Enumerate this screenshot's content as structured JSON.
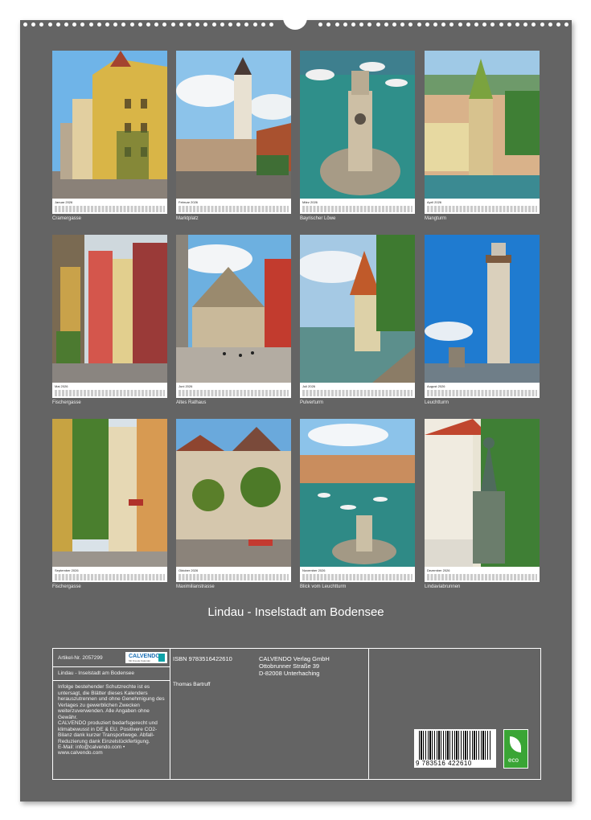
{
  "title": "Lindau - Inselstadt am Bodensee",
  "months": [
    {
      "month": "Januar 2026",
      "caption": "Cramergasse"
    },
    {
      "month": "Februar 2026",
      "caption": "Marktplatz"
    },
    {
      "month": "März 2026",
      "caption": "Bayrischer Löwe"
    },
    {
      "month": "April 2026",
      "caption": "Mangturm"
    },
    {
      "month": "Mai 2026",
      "caption": "Fischergasse"
    },
    {
      "month": "Juni 2026",
      "caption": "Altes Rathaus"
    },
    {
      "month": "Juli 2026",
      "caption": "Pulverturm"
    },
    {
      "month": "August 2026",
      "caption": "Leuchtturm"
    },
    {
      "month": "September 2026",
      "caption": "Fischergasse"
    },
    {
      "month": "Oktober 2026",
      "caption": "Maximilianstrasse"
    },
    {
      "month": "November 2026",
      "caption": "Blick vom Leuchtturm"
    },
    {
      "month": "Dezember 2026",
      "caption": "Lindaviabrunnen"
    }
  ],
  "info": {
    "article": "Artikel-Nr.  2057299",
    "logo_text": "CALVENDO",
    "logo_sub": "Mit Freude Kalender",
    "calendar_name": "Lindau - Inselstadt am Bodensee",
    "legal": "Infolge bestehender Schutzrechte ist es untersagt, die Blätter dieses Kalenders herauszutrennen und ohne Genehmigung des Verlages zu gewerblichen Zwecken weiterzuverwenden. Alle Angaben ohne Gewähr.",
    "eco_note": "CALVENDO produziert bedarfsgerecht und klimabewusst in DE & EU. Positivere CO2-Bilanz dank kurzer Transportwege. Abfall-Reduzierung dank Einzelstückfertigung.",
    "email": "E-Mail: info@calvendo.com •",
    "web": "www.calvendo.com",
    "isbn": "ISBN 9783516422610",
    "author": "Thomas Bartruff",
    "publisher": "CALVENDO Verlag GmbH",
    "street": "Ottobrunner Straße 39",
    "city": "D-82008 Unterhaching",
    "barcode_number": "9 783516 422610",
    "eco_label": "eco"
  },
  "colors": {
    "sheet": "#646464",
    "sky": "#5aa9e6",
    "water": "#2e8a86",
    "eco": "#3aa535"
  }
}
